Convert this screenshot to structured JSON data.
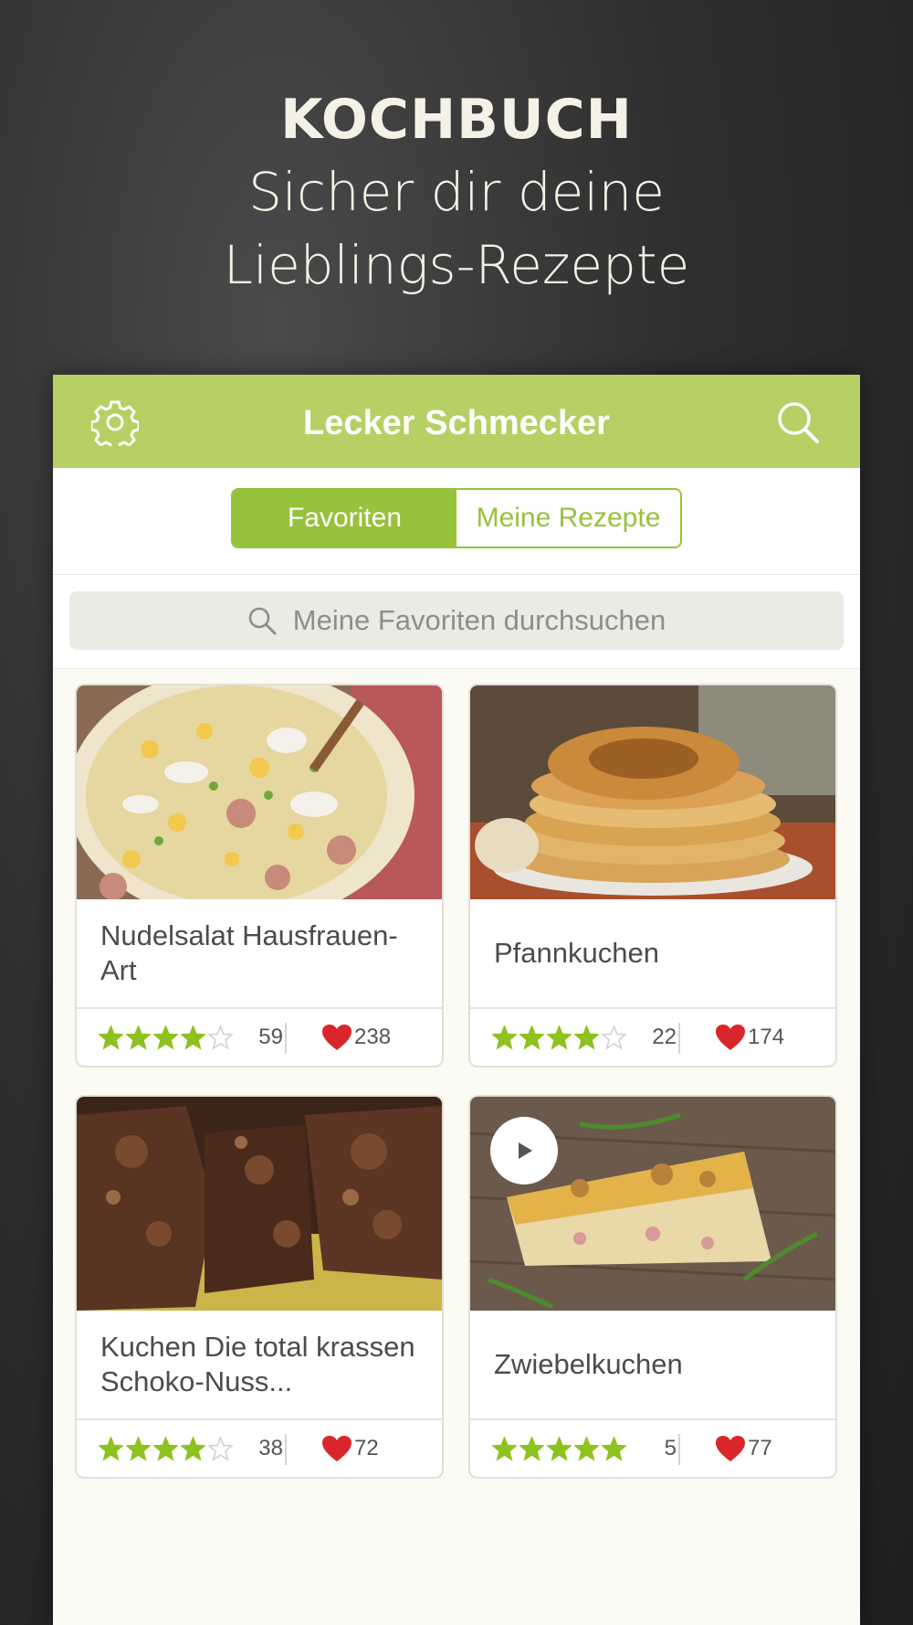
{
  "promo": {
    "title": "KOCHBUCH",
    "line1": "Sicher dir deine",
    "line2": "Lieblings-Rezepte"
  },
  "app": {
    "title": "Lecker Schmecker",
    "icons": {
      "left": "gear-icon",
      "right": "search-icon"
    }
  },
  "tabs": {
    "favorites": "Favoriten",
    "my_recipes": "Meine Rezepte",
    "active": "favorites"
  },
  "search": {
    "placeholder": "Meine Favoriten durchsuchen"
  },
  "colors": {
    "brand_green": "#b5d064",
    "active_green": "#97c23b",
    "star_green": "#8dc21f",
    "heart_red": "#d9262b"
  },
  "recipes": [
    {
      "title": "Nudelsalat Hausfrauen-Art",
      "stars": 4,
      "rating_count": "59",
      "likes": "238",
      "video": false
    },
    {
      "title": "Pfannkuchen",
      "stars": 4,
      "rating_count": "22",
      "likes": "174",
      "video": false
    },
    {
      "title": "Kuchen Die total krassen Schoko-Nuss...",
      "stars": 4,
      "rating_count": "38",
      "likes": "72",
      "video": false
    },
    {
      "title": "Zwiebelkuchen",
      "stars": 5,
      "rating_count": "5",
      "likes": "77",
      "video": true
    }
  ]
}
